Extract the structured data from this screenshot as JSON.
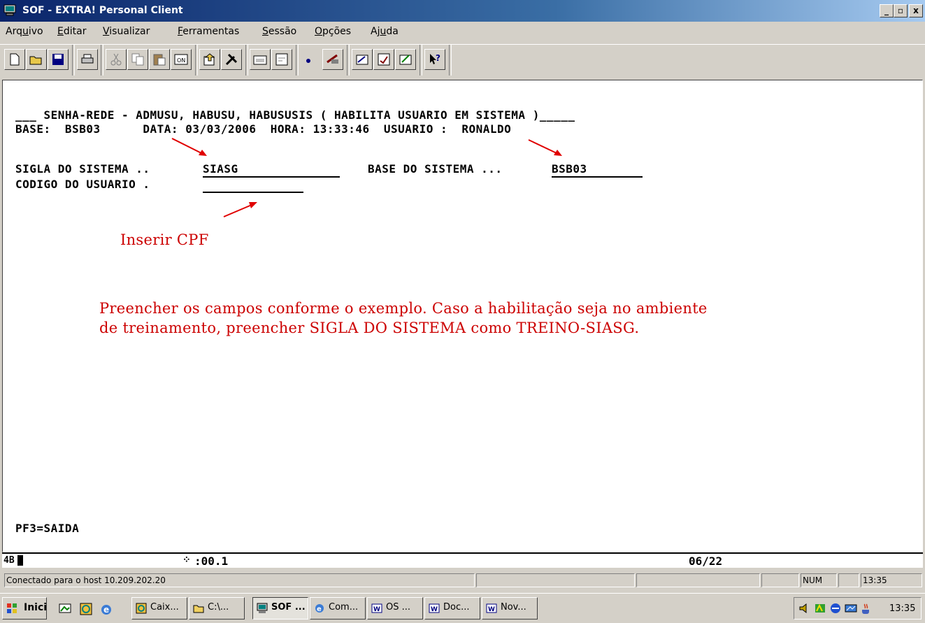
{
  "window": {
    "title": "SOF - EXTRA! Personal Client",
    "controls": [
      "_",
      "▫",
      "x"
    ]
  },
  "menubar": [
    {
      "pre": "Arq",
      "accel": "u",
      "post": "ivo"
    },
    {
      "pre": "",
      "accel": "E",
      "post": "ditar"
    },
    {
      "pre": "",
      "accel": "V",
      "post": "isualizar"
    },
    {
      "pre": "",
      "accel": "F",
      "post": "erramentas"
    },
    {
      "pre": "",
      "accel": "S",
      "post": "essão"
    },
    {
      "pre": "",
      "accel": "O",
      "post": "pções"
    },
    {
      "pre": "Aj",
      "accel": "u",
      "post": "da"
    }
  ],
  "toolbar": [
    "new-icon",
    "open-icon",
    "save-icon",
    "print-icon",
    "cut-icon",
    "copy-icon",
    "paste-icon",
    "transfer-icon",
    "upload-icon",
    "tools-icon",
    "keyboard-icon",
    "preferences-icon",
    "record-icon",
    "macro-icon",
    "edit-macro-icon",
    "settings-icon",
    "quickpad-icon",
    "help-icon"
  ],
  "terminal": {
    "header_line": "___ SENHA-REDE - ADMUSU, HABUSU, HABUSUSIS ( HABILITA USUARIO EM SISTEMA )_____",
    "info_line": "BASE:  BSB03      DATA: 03/03/2006  HORA: 13:33:46  USUARIO :  RONALDO",
    "sigla_label": "SIGLA DO SISTEMA ..",
    "sigla_value": "SIASG",
    "base_label": "BASE DO SISTEMA ...",
    "base_value": "BSB03",
    "codigo_label": "CODIGO DO USUARIO .",
    "codigo_value": "",
    "pf_keys": "PF3=SAIDA"
  },
  "annotations": {
    "cpf_hint": "Inserir CPF",
    "instructions_line1": "Preencher os campos conforme o exemplo. Caso a habilitação seja no ambiente",
    "instructions_line2": "de treinamento, preencher SIGLA DO SISTEMA como TREINO-SIASG.",
    "color": "#cc0000"
  },
  "oia": {
    "mode": "4B",
    "timer": ":00.1",
    "cursor_pos": "06/22"
  },
  "statusbar": {
    "connection": "Conectado para o host 10.209.202.20",
    "num": "NUM",
    "time": "13:35"
  },
  "taskbar": {
    "start_label": "Iniciar",
    "tasks": [
      {
        "label": "Caix...",
        "icon": "outlook-icon"
      },
      {
        "label": "C:\\...",
        "icon": "folder-icon"
      },
      {
        "label": "SOF ...",
        "icon": "terminal-icon",
        "active": true
      },
      {
        "label": "Com...",
        "icon": "browser-icon"
      },
      {
        "label": "OS ...",
        "icon": "word-icon"
      },
      {
        "label": "Doc...",
        "icon": "word-icon"
      },
      {
        "label": "Nov...",
        "icon": "word-icon"
      }
    ],
    "clock": "13:35"
  }
}
